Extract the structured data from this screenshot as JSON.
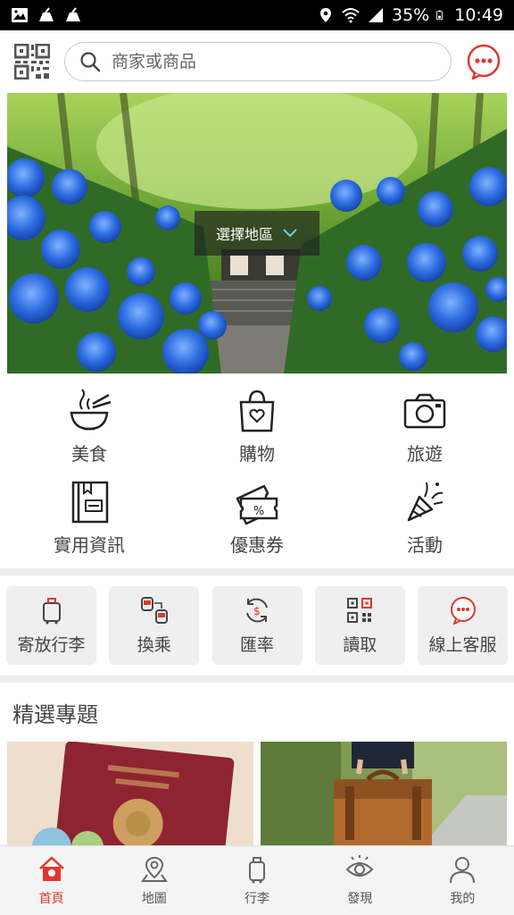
{
  "status_bar": {
    "battery": "35%",
    "time": "10:49"
  },
  "header": {
    "search_placeholder": "商家或商品"
  },
  "banner": {
    "region_label": "選擇地區"
  },
  "categories": [
    {
      "label": "美食",
      "icon": "food-bowl-icon"
    },
    {
      "label": "購物",
      "icon": "shopping-bag-icon"
    },
    {
      "label": "旅遊",
      "icon": "camera-icon"
    },
    {
      "label": "實用資訊",
      "icon": "guidebook-icon"
    },
    {
      "label": "優惠券",
      "icon": "coupon-icon"
    },
    {
      "label": "活動",
      "icon": "party-popper-icon"
    }
  ],
  "tools": [
    {
      "label": "寄放行李",
      "icon": "luggage-icon"
    },
    {
      "label": "換乘",
      "icon": "transfer-icon"
    },
    {
      "label": "匯率",
      "icon": "exchange-rate-icon"
    },
    {
      "label": "讀取",
      "icon": "qr-scan-icon"
    },
    {
      "label": "線上客服",
      "icon": "chat-icon"
    }
  ],
  "featured": {
    "title": "精選專題"
  },
  "tabbar": [
    {
      "label": "首頁",
      "icon": "home-icon",
      "active": true
    },
    {
      "label": "地圖",
      "icon": "map-pin-icon",
      "active": false
    },
    {
      "label": "行李",
      "icon": "luggage-icon",
      "active": false
    },
    {
      "label": "發現",
      "icon": "eye-icon",
      "active": false
    },
    {
      "label": "我的",
      "icon": "user-icon",
      "active": false
    }
  ],
  "colors": {
    "accent": "#e0372f",
    "tool_bg": "#efefef",
    "divider": "#eeeeee"
  }
}
